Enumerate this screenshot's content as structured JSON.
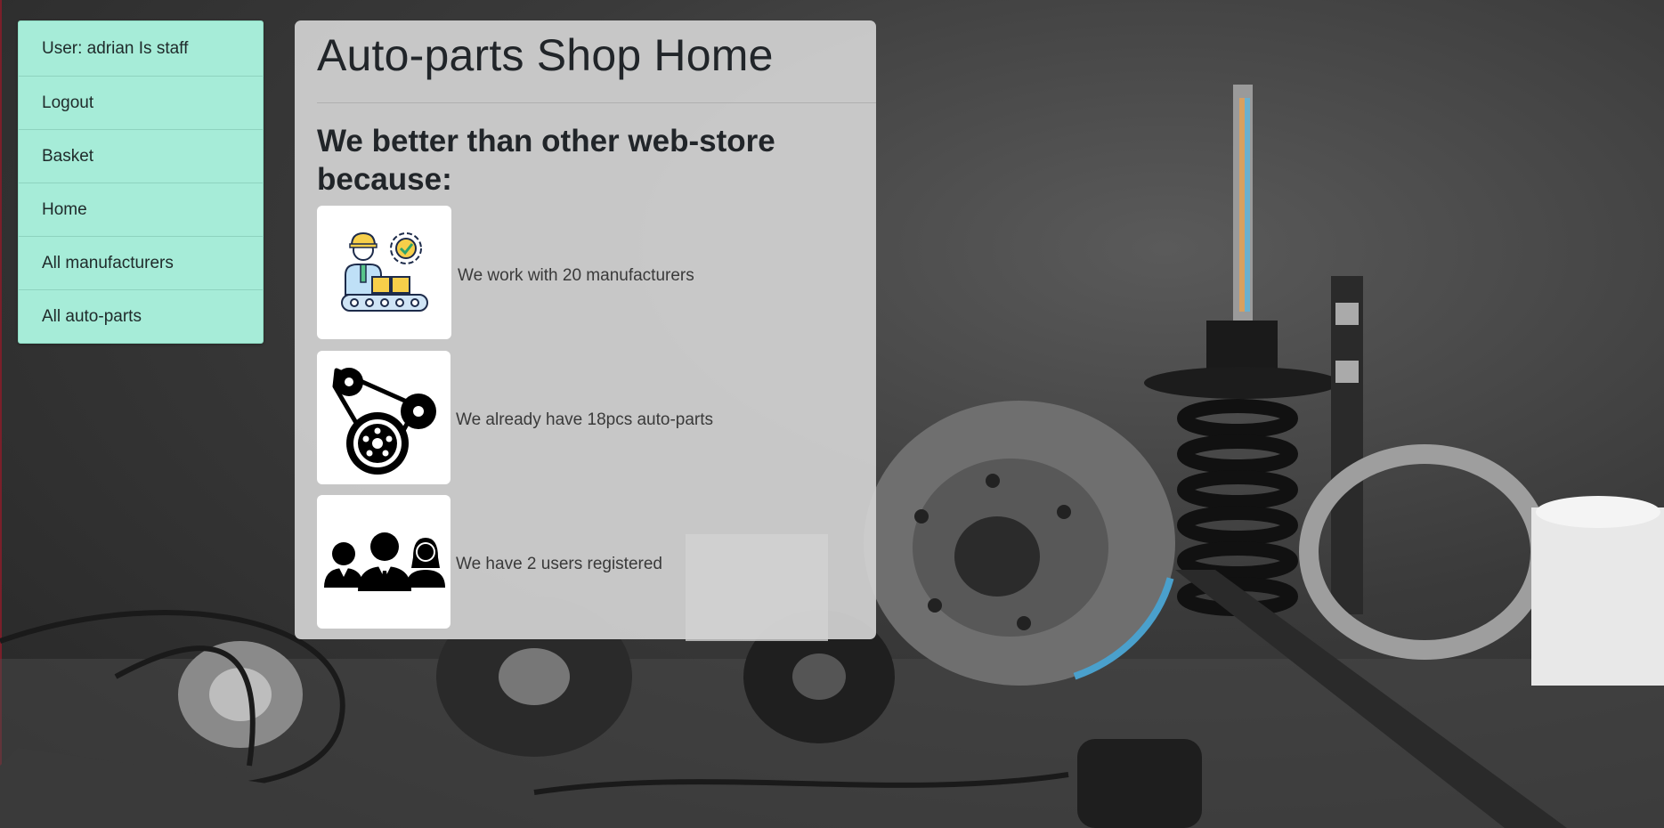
{
  "sidebar": {
    "items": [
      {
        "label": "User: adrian Is staff"
      },
      {
        "label": "Logout"
      },
      {
        "label": "Basket"
      },
      {
        "label": "Home"
      },
      {
        "label": "All manufacturers"
      },
      {
        "label": "All auto-parts"
      }
    ]
  },
  "main": {
    "title": "Auto-parts Shop Home",
    "subtitle": "We better than other web-store because:",
    "features": [
      {
        "icon": "factory-worker-conveyor-icon",
        "text": "We work with 20 manufacturers"
      },
      {
        "icon": "belt-pulleys-icon",
        "text": "We already have 18pcs auto-parts"
      },
      {
        "icon": "users-group-icon",
        "text": "We have 2 users registered"
      }
    ]
  },
  "colors": {
    "sidebar_bg": "#a6ecd8",
    "panel_bg": "#d2d2d2",
    "text_dark": "#212529"
  }
}
